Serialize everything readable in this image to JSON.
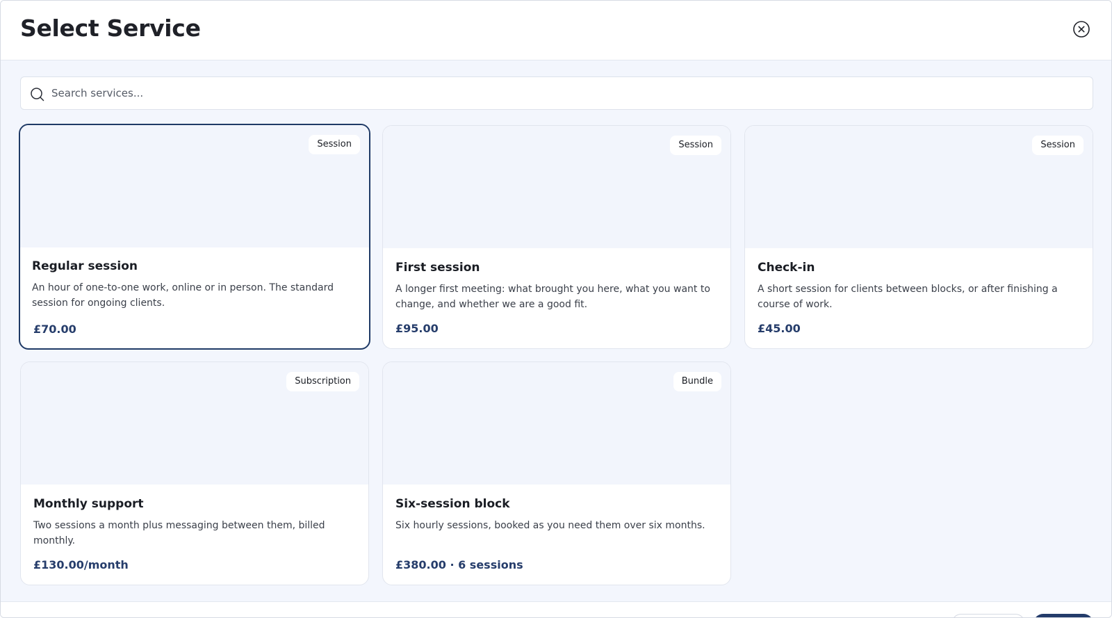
{
  "modal": {
    "title": "Select Service"
  },
  "search": {
    "placeholder": "Search services..."
  },
  "services": [
    {
      "badge": "Session",
      "title": "Regular session",
      "description": "An hour of one-to-one work, online or in person. The standard session for ongoing clients.",
      "price": "£70.00",
      "selected": true
    },
    {
      "badge": "Session",
      "title": "First session",
      "description": "A longer first meeting: what brought you here, what you want to change, and whether we are a good fit.",
      "price": "£95.00",
      "selected": false
    },
    {
      "badge": "Session",
      "title": "Check-in",
      "description": "A short session for clients between blocks, or after finishing a course of work.",
      "price": "£45.00",
      "selected": false
    },
    {
      "badge": "Subscription",
      "title": "Monthly support",
      "description": "Two sessions a month plus messaging between them, billed monthly.",
      "price": "£130.00/month",
      "selected": false
    },
    {
      "badge": "Bundle",
      "title": "Six-session block",
      "description": "Six hourly sessions, booked as you need them over six months.",
      "price": "£380.00 · 6 sessions",
      "selected": false
    }
  ],
  "icons": {
    "close": "close-circle-icon",
    "search": "search-icon"
  },
  "colors": {
    "accent": "#1f3a66",
    "price": "#263d6b",
    "background": "#f3f6fd"
  }
}
